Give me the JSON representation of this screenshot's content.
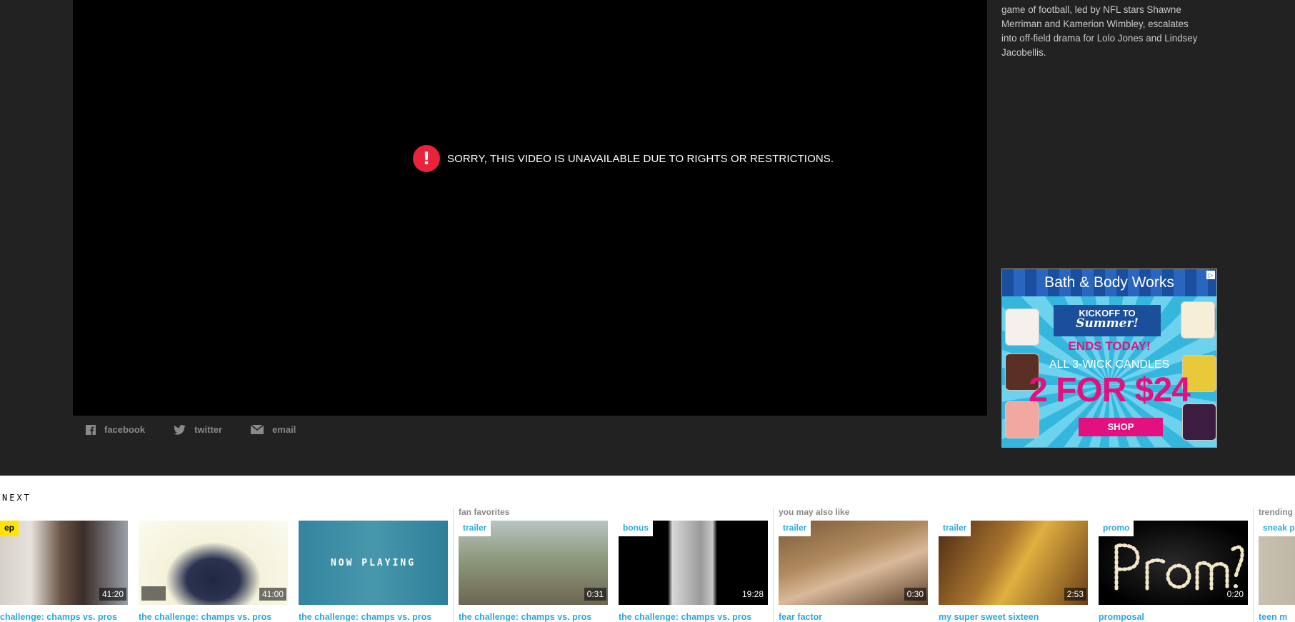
{
  "player": {
    "error_icon": "!",
    "error_message": "SORRY, THIS VIDEO IS UNAVAILABLE DUE TO RIGHTS OR RESTRICTIONS."
  },
  "share": {
    "facebook": "facebook",
    "twitter": "twitter",
    "email": "email"
  },
  "description": {
    "line1": "game of football, led by NFL stars Shawne",
    "line2": "Merriman and Kamerion Wimbley, escalates",
    "line3": "into off-field drama for Lolo Jones and Lindsey",
    "line4": "Jacobellis."
  },
  "ad": {
    "brand": "Bath & Body Works",
    "adchoices_icon": "▷",
    "headline_top": "KICKOFF TO",
    "headline_script": "Summer!",
    "ends": "ENDS TODAY!",
    "offer": "ALL 3-WICK CANDLES",
    "price": "2 FOR $24",
    "cta": "SHOP",
    "colors": {
      "blue": "#1b4f9b",
      "pink": "#e3117f",
      "sky": "#34b6dd"
    }
  },
  "up_next": {
    "label": "NEXT",
    "sections": {
      "fan_favorites": "fan favorites",
      "you_may_also_like": "you may also like",
      "trending": "trending"
    },
    "cards": [
      {
        "tag": "ep",
        "duration": "41:20",
        "title": "challenge: champs vs. pros"
      },
      {
        "tag": "",
        "duration": "41:00",
        "title": "the challenge: champs vs. pros"
      },
      {
        "tag": "",
        "duration": "",
        "overlay": "NOW PLAYING",
        "title": "the challenge: champs vs. pros"
      },
      {
        "tag": "trailer",
        "duration": "0:31",
        "title": "the challenge: champs vs. pros"
      },
      {
        "tag": "bonus",
        "duration": "19:28",
        "title": "the challenge: champs vs. pros"
      },
      {
        "tag": "trailer",
        "duration": "0:30",
        "title": "fear factor"
      },
      {
        "tag": "trailer",
        "duration": "2:53",
        "title": "my super sweet sixteen"
      },
      {
        "tag": "promo",
        "duration": "0:20",
        "title": "promposal"
      },
      {
        "tag": "sneak p",
        "duration": "",
        "title": "teen m"
      }
    ]
  }
}
